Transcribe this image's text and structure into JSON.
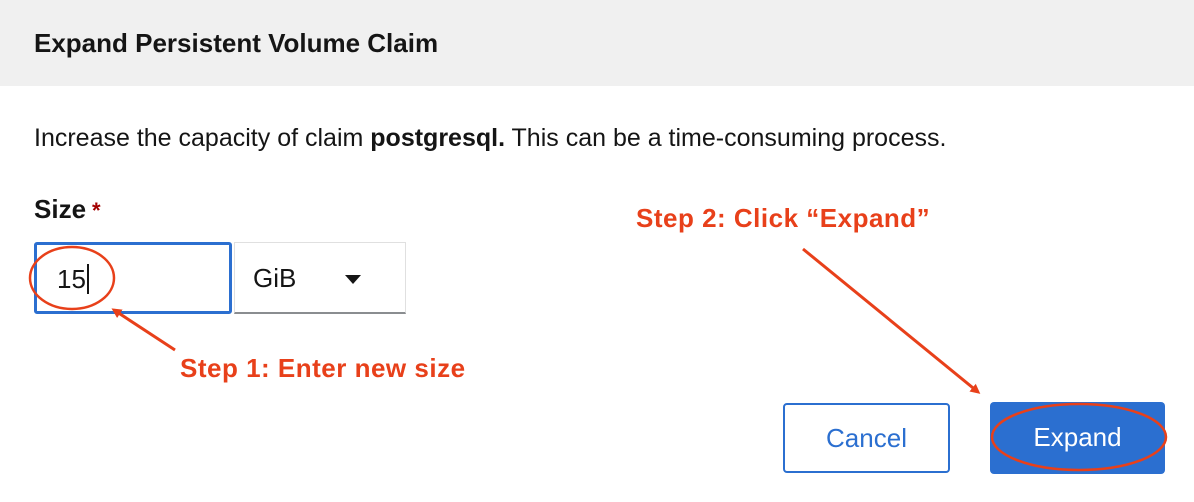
{
  "dialog": {
    "title": "Expand Persistent Volume Claim",
    "description_prefix": "Increase the capacity of claim ",
    "claim_name": "postgresql.",
    "description_suffix": " This can be a time-consuming process."
  },
  "form": {
    "size_label": "Size",
    "required_marker": "*",
    "size_value": "15",
    "unit_selected": "GiB"
  },
  "buttons": {
    "cancel_label": "Cancel",
    "expand_label": "Expand"
  },
  "annotations": {
    "step1": "Step 1: Enter new size",
    "step2": "Step 2: Click “Expand”",
    "color": "#e8401a"
  },
  "colors": {
    "primary": "#2b6fd0",
    "header_bg": "#f0f0f0",
    "required": "#a30000"
  }
}
